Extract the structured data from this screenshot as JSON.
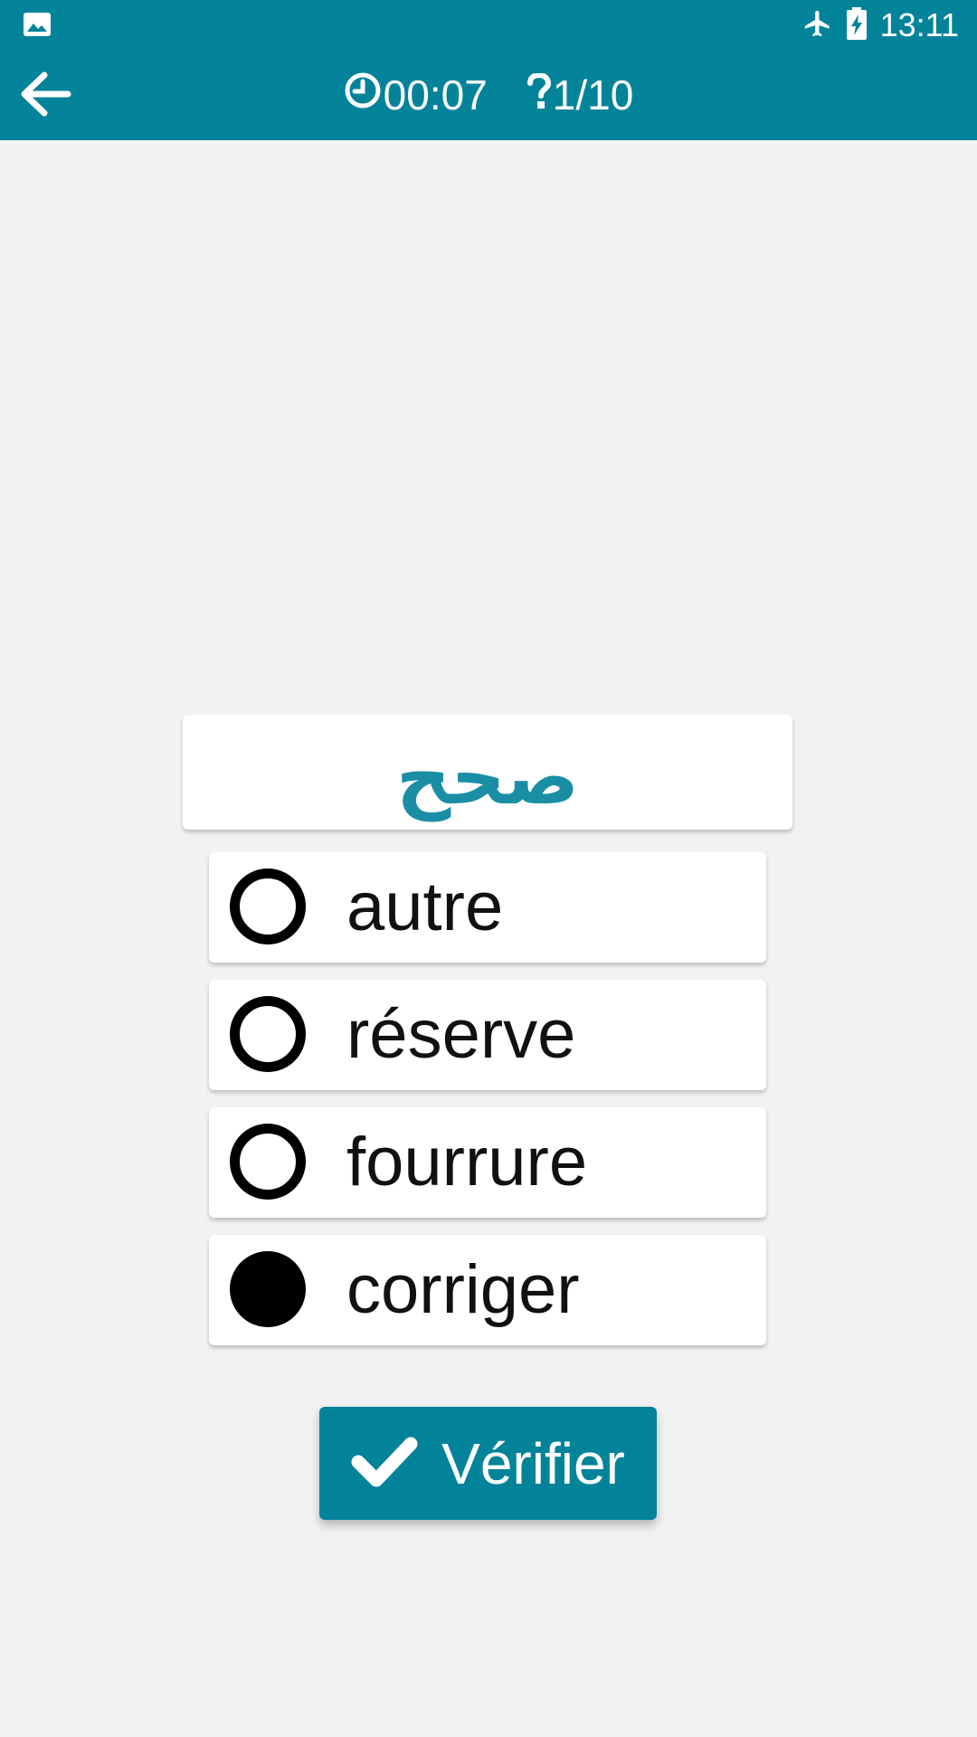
{
  "status_bar": {
    "left_icon": "image-icon",
    "icons": [
      "airplane-mode-icon",
      "battery-charging-icon"
    ],
    "time": "13:11"
  },
  "app_bar": {
    "back_icon": "arrow-back-icon",
    "timer_icon": "clock-icon",
    "timer": "00:07",
    "question_icon": "question-mark-icon",
    "progress": "1/10"
  },
  "quiz": {
    "question_word": "صحح",
    "options": [
      {
        "label": "autre",
        "selected": false
      },
      {
        "label": "réserve",
        "selected": false
      },
      {
        "label": "fourrure",
        "selected": false
      },
      {
        "label": "corriger",
        "selected": true
      }
    ],
    "verify_button": {
      "label": "Vérifier",
      "icon": "check-icon"
    }
  },
  "colors": {
    "primary": "#03839a",
    "question_text": "#1a8ea5",
    "background": "#f2f2f2"
  }
}
